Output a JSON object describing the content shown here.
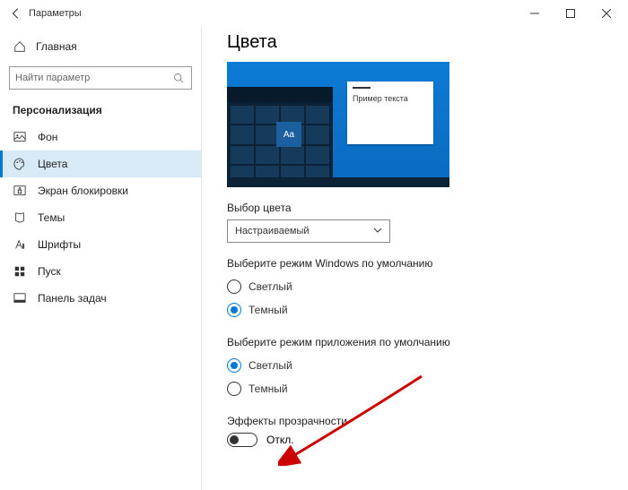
{
  "window": {
    "title": "Параметры"
  },
  "sidebar": {
    "home": "Главная",
    "search_placeholder": "Найти параметр",
    "category": "Персонализация",
    "items": [
      {
        "label": "Фон"
      },
      {
        "label": "Цвета"
      },
      {
        "label": "Экран блокировки"
      },
      {
        "label": "Темы"
      },
      {
        "label": "Шрифты"
      },
      {
        "label": "Пуск"
      },
      {
        "label": "Панель задач"
      }
    ]
  },
  "content": {
    "title": "Цвета",
    "preview_sample_text": "Пример текста",
    "preview_tile": "Aa",
    "color_mode_label": "Выбор цвета",
    "color_mode_value": "Настраиваемый",
    "windows_mode_label": "Выберите режим Windows по умолчанию",
    "windows_mode": {
      "light": "Светлый",
      "dark": "Темный",
      "selected": "dark"
    },
    "app_mode_label": "Выберите режим приложения по умолчанию",
    "app_mode": {
      "light": "Светлый",
      "dark": "Темный",
      "selected": "light"
    },
    "transparency_label": "Эффекты прозрачности",
    "transparency_state": "Откл."
  },
  "colors": {
    "accent": "#0078d4"
  }
}
